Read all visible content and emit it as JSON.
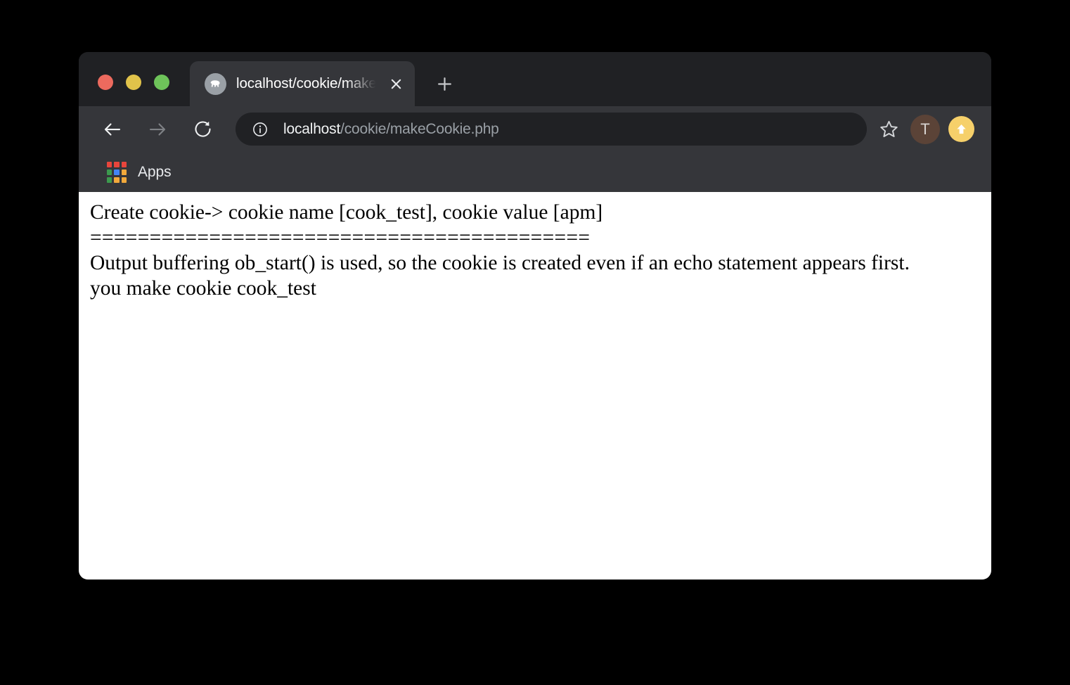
{
  "window": {
    "traffic_lights": [
      {
        "name": "close",
        "color": "#ec6a5e"
      },
      {
        "name": "minimize",
        "color": "#e1c34a"
      },
      {
        "name": "zoom",
        "color": "#6ec45a"
      }
    ]
  },
  "tab": {
    "title": "localhost/cookie/makeCookie.php",
    "favicon": "php-elephant-icon",
    "close_icon": "close-icon",
    "new_tab_icon": "plus-icon"
  },
  "toolbar": {
    "back_icon": "back-arrow-icon",
    "forward_icon": "forward-arrow-icon",
    "reload_icon": "reload-icon",
    "site_info_icon": "info-circle-icon",
    "url_host": "localhost",
    "url_path": "/cookie/makeCookie.php",
    "bookmark_icon": "star-outline-icon",
    "profile_initial": "T",
    "update_icon": "arrow-up-icon"
  },
  "bookmarks_bar": {
    "apps_label": "Apps",
    "apps_icon": "apps-grid-icon",
    "apps_grid_colors": [
      "#e8453c",
      "#e8453c",
      "#e8453c",
      "#3c9a4e",
      "#4285f4",
      "#f2a93b",
      "#3c9a4e",
      "#f2a93b",
      "#f2a93b"
    ]
  },
  "page": {
    "line1": "Create cookie-> cookie name [cook_test], cookie value [apm]",
    "divider": "==========================================",
    "line2": "Output buffering ob_start() is used, so the cookie is created even if an echo statement appears first.",
    "line3": "you make cookie cook_test"
  }
}
